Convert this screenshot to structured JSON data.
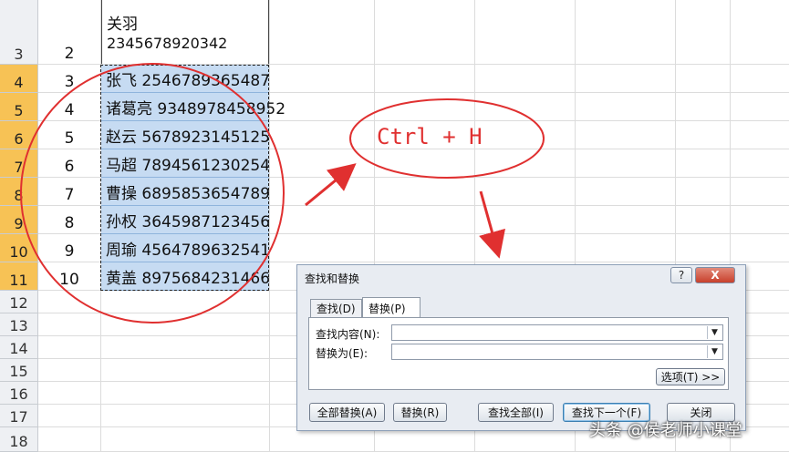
{
  "rows": [
    {
      "num": "3",
      "b": "2",
      "selected": false
    },
    {
      "num": "4",
      "b": "3",
      "c": "张飞 2546789365487",
      "selected": true
    },
    {
      "num": "5",
      "b": "4",
      "c": "诸葛亮 9348978458952",
      "selected": true
    },
    {
      "num": "6",
      "b": "5",
      "c": "赵云 5678923145125",
      "selected": true
    },
    {
      "num": "7",
      "b": "6",
      "c": "马超 7894561230254",
      "selected": true
    },
    {
      "num": "8",
      "b": "7",
      "c": "曹操 6895853654789",
      "selected": true
    },
    {
      "num": "9",
      "b": "8",
      "c": "孙权 3645987123456",
      "selected": true
    },
    {
      "num": "10",
      "b": "9",
      "c": "周瑜 4564789632541",
      "selected": true
    },
    {
      "num": "11",
      "b": "10",
      "c": "黄盖 8975684231466",
      "selected": true
    },
    {
      "num": "12"
    },
    {
      "num": "13"
    },
    {
      "num": "14"
    },
    {
      "num": "15"
    },
    {
      "num": "16"
    },
    {
      "num": "17"
    },
    {
      "num": "18"
    }
  ],
  "row3_c": {
    "line1": "关羽",
    "line2": "2345678920342"
  },
  "annotation": {
    "shortcut": "Ctrl + H",
    "color": "#e03030"
  },
  "dialog": {
    "title": "查找和替换",
    "help_label": "?",
    "close_label": "X",
    "tabs": [
      {
        "label": "查找(D)",
        "active": false
      },
      {
        "label": "替换(P)",
        "active": true
      }
    ],
    "find_label": "查找内容(N):",
    "find_value": "",
    "replace_label": "替换为(E):",
    "replace_value": "",
    "options_label": "选项(T) >>",
    "buttons": {
      "replace_all": "全部替换(A)",
      "replace": "替换(R)",
      "find_all": "查找全部(I)",
      "find_next": "查找下一个(F)",
      "close": "关闭"
    }
  },
  "watermark": "头条 @侯老师小课堂",
  "colors": {
    "selection": "#c6dbf2",
    "row_header_selected": "#f7c255"
  }
}
